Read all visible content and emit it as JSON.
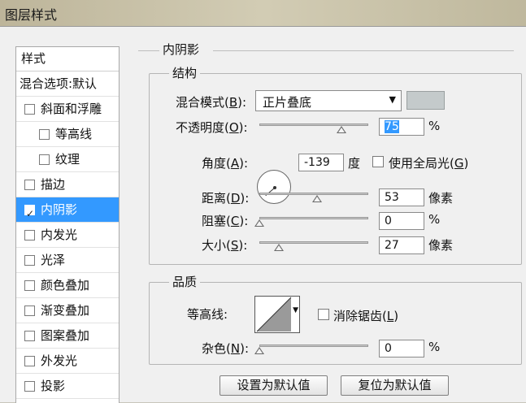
{
  "window": {
    "title": "图层样式"
  },
  "sidebar": {
    "header": "样式",
    "blend_options": "混合选项:默认",
    "items": [
      {
        "label": "斜面和浮雕",
        "checked": false,
        "indent": false,
        "selected": false
      },
      {
        "label": "等高线",
        "checked": false,
        "indent": true,
        "selected": false
      },
      {
        "label": "纹理",
        "checked": false,
        "indent": true,
        "selected": false
      },
      {
        "label": "描边",
        "checked": false,
        "indent": false,
        "selected": false
      },
      {
        "label": "内阴影",
        "checked": true,
        "indent": false,
        "selected": true
      },
      {
        "label": "内发光",
        "checked": false,
        "indent": false,
        "selected": false
      },
      {
        "label": "光泽",
        "checked": false,
        "indent": false,
        "selected": false
      },
      {
        "label": "颜色叠加",
        "checked": false,
        "indent": false,
        "selected": false
      },
      {
        "label": "渐变叠加",
        "checked": false,
        "indent": false,
        "selected": false
      },
      {
        "label": "图案叠加",
        "checked": false,
        "indent": false,
        "selected": false
      },
      {
        "label": "外发光",
        "checked": false,
        "indent": false,
        "selected": false
      },
      {
        "label": "投影",
        "checked": false,
        "indent": false,
        "selected": false
      }
    ]
  },
  "panel": {
    "title": "内阴影",
    "structure": {
      "title": "结构",
      "blend_mode": {
        "label": "混合模式(",
        "key": "B",
        "suffix": "):",
        "value": "正片叠底",
        "color": "#c4cacb"
      },
      "opacity": {
        "label": "不透明度(",
        "key": "O",
        "suffix": "):",
        "value": "75",
        "unit": "%",
        "slider": 0.75
      },
      "angle": {
        "label": "角度(",
        "key": "A",
        "suffix": "):",
        "value": "-139",
        "unit": "度",
        "global_label": "使用全局光(",
        "global_key": "G",
        "global_suffix": ")",
        "global_checked": false
      },
      "distance": {
        "label": "距离(",
        "key": "D",
        "suffix": "):",
        "value": "53",
        "unit": "像素",
        "slider": 0.53
      },
      "choke": {
        "label": "阻塞(",
        "key": "C",
        "suffix": "):",
        "value": "0",
        "unit": "%",
        "slider": 0.0
      },
      "size": {
        "label": "大小(",
        "key": "S",
        "suffix": "):",
        "value": "27",
        "unit": "像素",
        "slider": 0.18
      }
    },
    "quality": {
      "title": "品质",
      "contour_label": "等高线:",
      "antialias": {
        "label": "消除锯齿(",
        "key": "L",
        "suffix": ")",
        "checked": false
      },
      "noise": {
        "label": "杂色(",
        "key": "N",
        "suffix": "):",
        "value": "0",
        "unit": "%",
        "slider": 0.0
      }
    },
    "buttons": {
      "make_default": "设置为默认值",
      "reset_default": "复位为默认值"
    }
  }
}
